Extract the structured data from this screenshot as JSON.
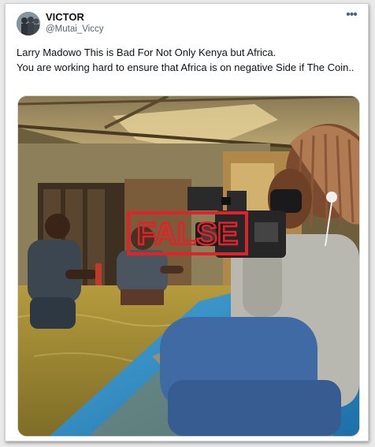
{
  "tweet": {
    "author_name": "VICTOR",
    "author_handle": "@Mutai_Viccy",
    "more_icon": "more-horizontal-icon",
    "text": "Larry Madowo This is Bad For Not Only Kenya but Africa.\nYou are working hard to ensure that Africa is on negative Side if The Coin..",
    "stamp_text": "FALSE",
    "stamp_color": "#e0232b"
  }
}
